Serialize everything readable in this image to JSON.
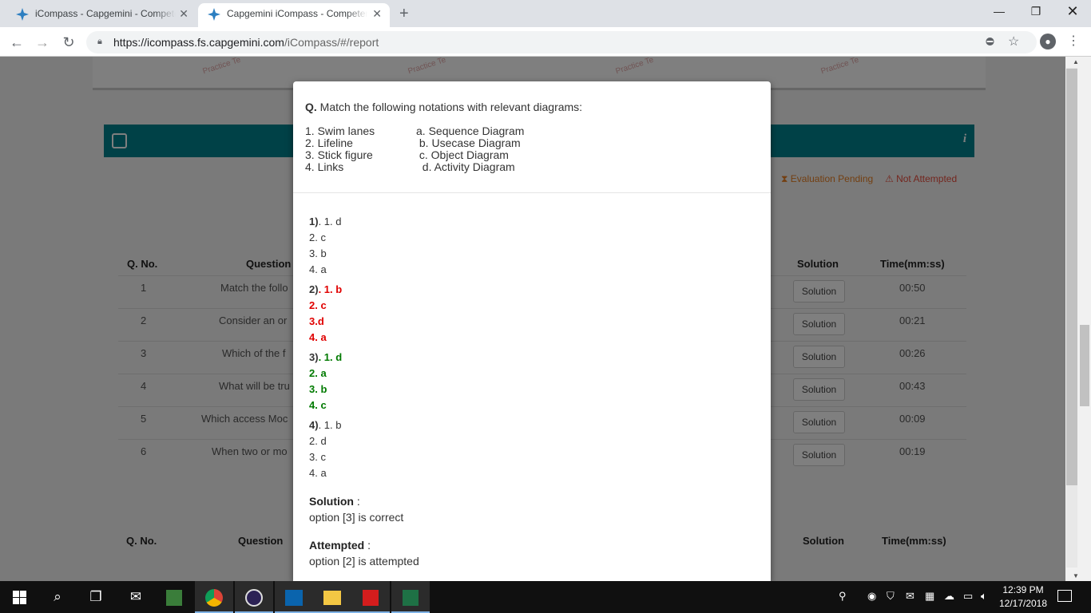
{
  "browser": {
    "tabs": [
      {
        "title": "iCompass - Capgemini - Competency",
        "active": false
      },
      {
        "title": "Capgemini iCompass - Competency",
        "active": true
      }
    ],
    "url_host": "https://icompass.fs.capgemini.com",
    "url_path": "/iCompass/#/report"
  },
  "background": {
    "watermark": "Practice Te",
    "legend_pending": "Evaluation Pending",
    "legend_not_attempted": "Not Attempted",
    "table_headers": {
      "qno": "Q. No.",
      "question": "Question",
      "solution": "Solution",
      "time": "Time(mm:ss)"
    },
    "rows": [
      {
        "no": "1",
        "question": "Match the follo",
        "solution": "Solution",
        "time": "00:50"
      },
      {
        "no": "2",
        "question": "Consider an or",
        "solution": "Solution",
        "time": "00:21"
      },
      {
        "no": "3",
        "question": "Which of the f",
        "solution": "Solution",
        "time": "00:26"
      },
      {
        "no": "4",
        "question": "What will be tru",
        "solution": "Solution",
        "time": "00:43"
      },
      {
        "no": "5",
        "question": "Which access Moc",
        "solution": "Solution",
        "time": "00:09"
      },
      {
        "no": "6",
        "question": "When two or mo",
        "solution": "Solution",
        "time": "00:19"
      }
    ]
  },
  "modal": {
    "q_prefix": "Q.",
    "question": "Match the following notations with relevant diagrams:",
    "left_items": [
      "1. Swim lanes",
      "2. Lifeline",
      "3. Stick figure",
      "4. Links"
    ],
    "right_items": [
      "a. Sequence Diagram",
      " b. Usecase Diagram",
      " c. Object Diagram",
      "  d. Activity Diagram"
    ],
    "options": [
      {
        "num": "1)",
        "first": "1. d",
        "rest": [
          "2. c",
          "3. b",
          "4. a"
        ],
        "status": "normal"
      },
      {
        "num": "2)",
        "first": "1. b",
        "rest": [
          "2. c",
          "3.d",
          "4. a"
        ],
        "status": "attempted-wrong"
      },
      {
        "num": "3)",
        "first": "1. d",
        "rest": [
          "2. a",
          "3. b",
          "4. c"
        ],
        "status": "correct"
      },
      {
        "num": "4)",
        "first": "1. b",
        "rest": [
          "2. d",
          "3. c",
          "4. a"
        ],
        "status": "normal"
      }
    ],
    "solution_label": "Solution",
    "solution_text": "option [3] is correct",
    "attempted_label": "Attempted",
    "attempted_text": "option [2] is attempted",
    "colon": " :"
  },
  "taskbar": {
    "time": "12:39 PM",
    "date": "12/17/2018"
  },
  "colors": {
    "teal": "#00838f",
    "correct": "#007a00",
    "wrong": "#e00000"
  }
}
